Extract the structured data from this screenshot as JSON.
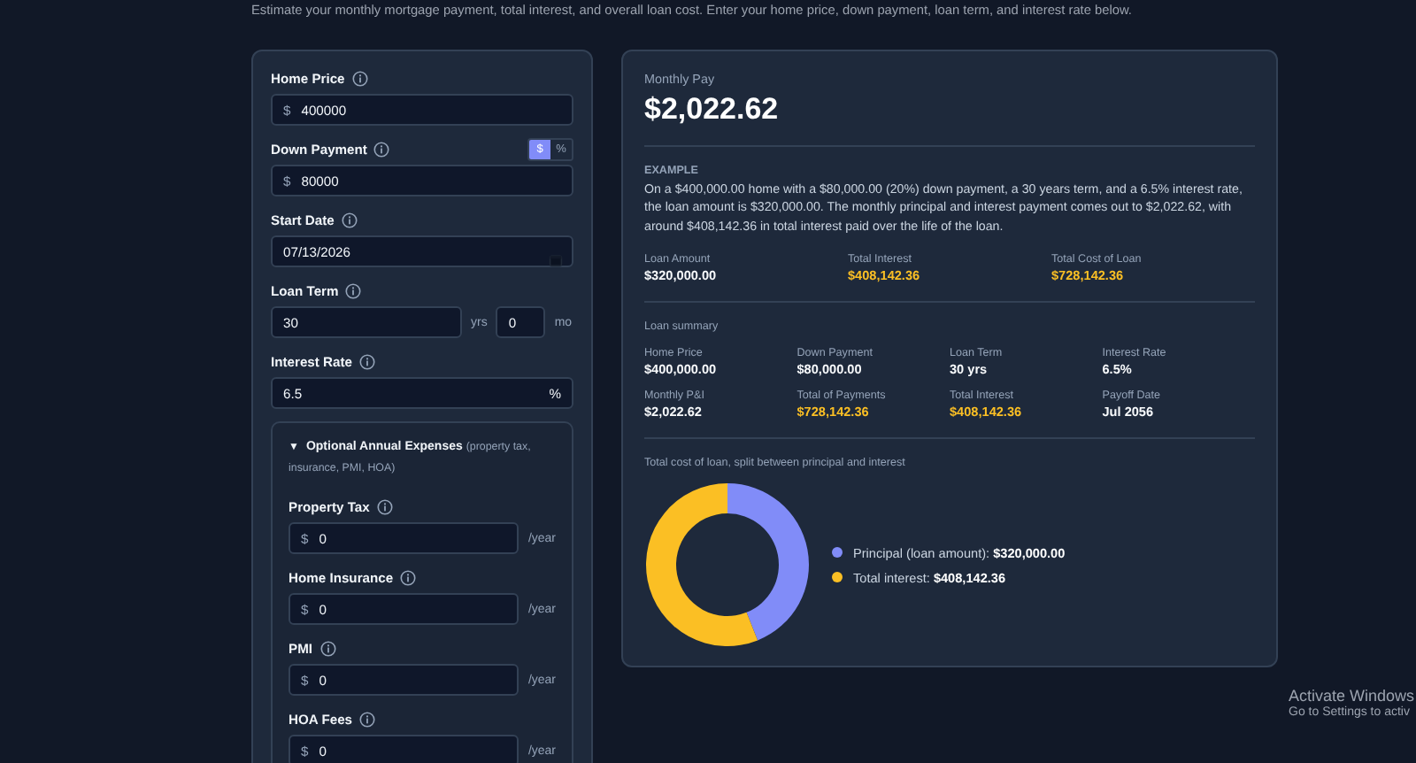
{
  "intro": "Estimate your monthly mortgage payment, total interest, and overall loan cost. Enter your home price, down payment, loan term, and interest rate below.",
  "form": {
    "fields": [
      {
        "kind": "money",
        "label": "Home Price",
        "prefix": "$",
        "value": "400000"
      },
      {
        "kind": "money",
        "label": "Down Payment",
        "prefix": "$",
        "value": "80000",
        "toggle": [
          {
            "label": "$",
            "selected": true
          },
          {
            "label": "%",
            "selected": false
          }
        ]
      },
      {
        "kind": "date",
        "label": "Start Date",
        "value": "07/13/2026"
      },
      {
        "kind": "term",
        "label": "Loan Term",
        "years": "30",
        "years_unit": "yrs",
        "months": "0",
        "months_unit": "mo"
      },
      {
        "kind": "percent",
        "label": "Interest Rate",
        "value": "6.5",
        "suffix": "%"
      }
    ],
    "optional": {
      "expanded": true,
      "marker": "▼",
      "title": "Optional Annual Expenses",
      "note": "(property tax, insurance, PMI, HOA)",
      "fields": [
        {
          "label": "Property Tax",
          "prefix": "$",
          "value": "0",
          "suffix": "/year"
        },
        {
          "label": "Home Insurance",
          "prefix": "$",
          "value": "0",
          "suffix": "/year"
        },
        {
          "label": "PMI",
          "prefix": "$",
          "value": "0",
          "suffix": "/year"
        },
        {
          "label": "HOA Fees",
          "prefix": "$",
          "value": "0",
          "suffix": "/year"
        }
      ]
    }
  },
  "results": {
    "monthly_label": "Monthly Pay",
    "monthly_value": "$2,022.62",
    "example_heading": "EXAMPLE",
    "example_text": "On a $400,000.00 home with a $80,000.00 (20%) down payment, a 30 years term, and a 6.5% interest rate, the loan amount is $320,000.00. The monthly principal and interest payment comes out to $2,022.62, with around $408,142.36 in total interest paid over the life of the loan.",
    "stats": [
      {
        "label": "Loan Amount",
        "value": "$320,000.00",
        "highlight": false
      },
      {
        "label": "Total Interest",
        "value": "$408,142.36",
        "highlight": true
      },
      {
        "label": "Total Cost of Loan",
        "value": "$728,142.36",
        "highlight": true
      }
    ],
    "summary_title": "Loan summary",
    "summary": [
      {
        "label": "Home Price",
        "value": "$400,000.00",
        "highlight": false
      },
      {
        "label": "Down Payment",
        "value": "$80,000.00",
        "highlight": false
      },
      {
        "label": "Loan Term",
        "value": "30 yrs",
        "highlight": false
      },
      {
        "label": "Interest Rate",
        "value": "6.5%",
        "highlight": false
      },
      {
        "label": "Monthly P&I",
        "value": "$2,022.62",
        "highlight": false
      },
      {
        "label": "Total of Payments",
        "value": "$728,142.36",
        "highlight": true
      },
      {
        "label": "Total Interest",
        "value": "$408,142.36",
        "highlight": true
      },
      {
        "label": "Payoff Date",
        "value": "Jul 2056",
        "highlight": false
      }
    ],
    "chart_title": "Total cost of loan, split between principal and interest",
    "chart_data": {
      "type": "donut",
      "values": [
        43.95,
        56.05
      ]
    },
    "legend": [
      {
        "text": "Principal (loan amount): **$320,000.00**",
        "color": "#818cf8"
      },
      {
        "text": "Total interest: **$408,142.36**",
        "color": "#fbbf24"
      }
    ]
  },
  "os_notice": {
    "title": "Activate Windows",
    "text": "Go to Settings to activ"
  }
}
